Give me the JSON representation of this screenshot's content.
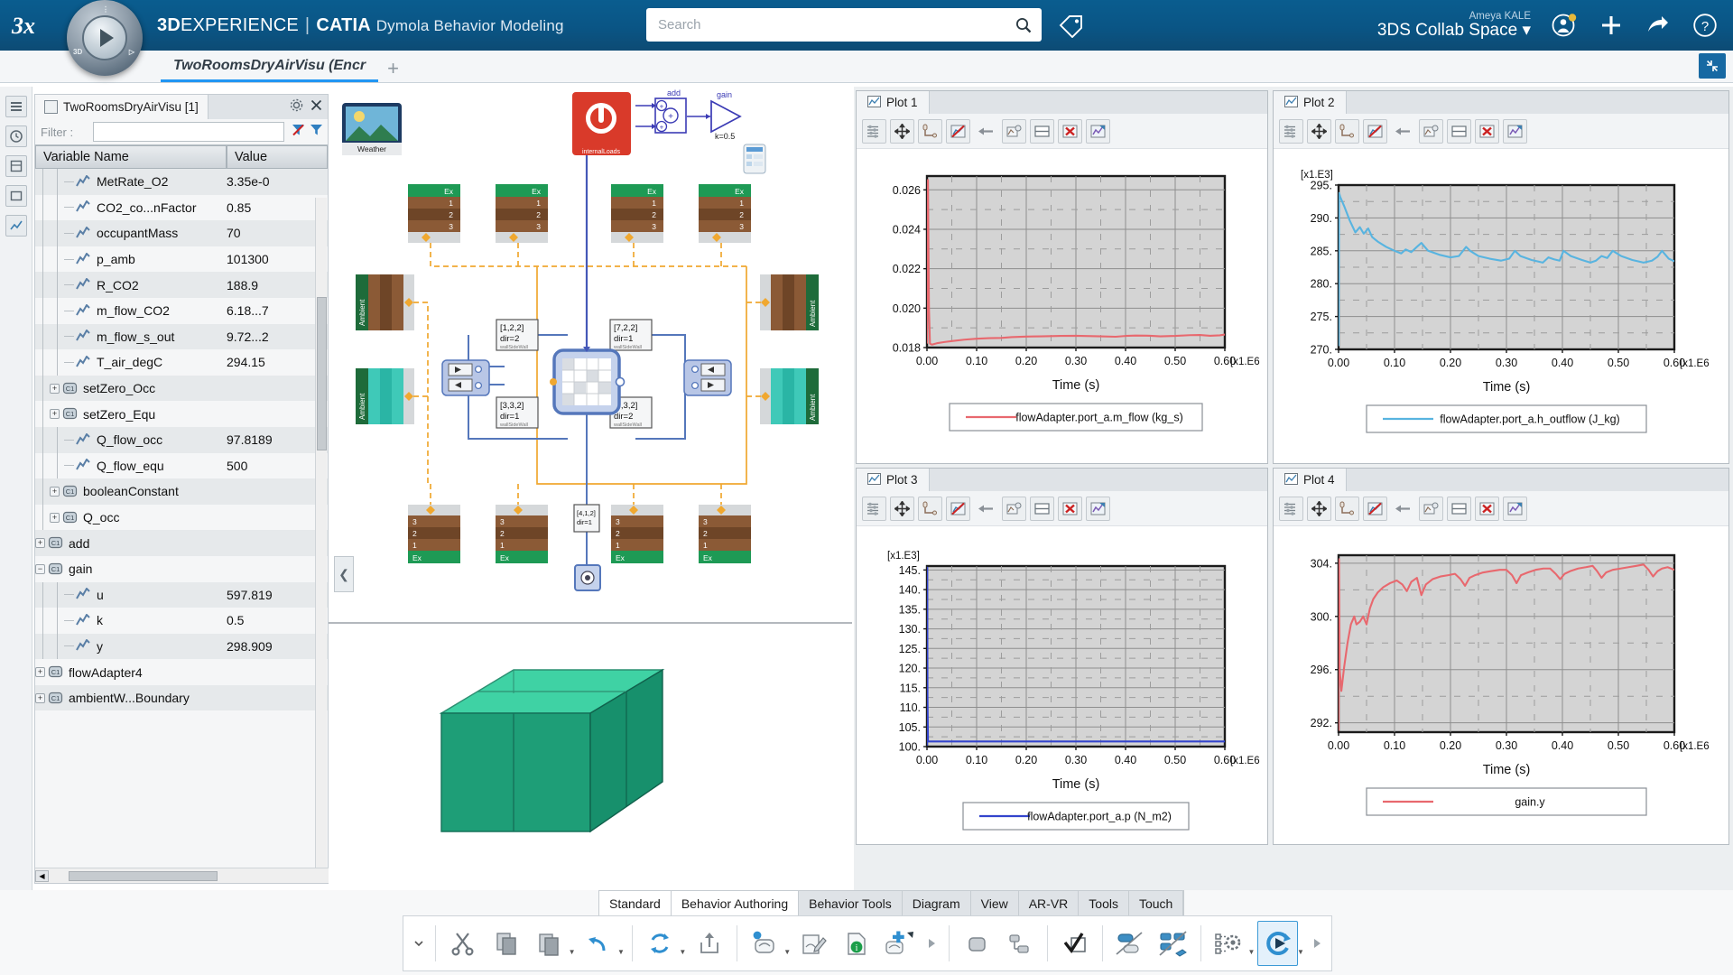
{
  "header": {
    "brand_bold": "3D",
    "brand_rest": "EXPERIENCE",
    "brand_sep": "|",
    "brand_app": "CATIA",
    "brand_sub": "Dymola Behavior Modeling",
    "search_placeholder": "Search",
    "search_value": "",
    "user_name": "Ameya KALE",
    "collab_space": "3DS Collab Space",
    "collab_caret": "⌄",
    "icons": [
      "search-icon",
      "tag-icon",
      "user-account-icon",
      "add-icon",
      "share-icon",
      "help-icon"
    ]
  },
  "tabbar": {
    "document_tab": "TwoRoomsDryAirVisu (Encr",
    "add_tab": "+",
    "collapse_label": "⇲"
  },
  "variable_panel": {
    "tab_title": "TwoRoomsDryAirVisu [1]",
    "filter_label": "Filter :",
    "filter_value": "",
    "columns": [
      "Variable Name",
      "Value"
    ],
    "rows": [
      {
        "name": "MetRate_O2",
        "value": "3.35e-0",
        "indent": 3,
        "kind": "signal"
      },
      {
        "name": "CO2_co...nFactor",
        "value": "0.85",
        "indent": 3,
        "kind": "signal"
      },
      {
        "name": "occupantMass",
        "value": "70",
        "indent": 3,
        "kind": "signal"
      },
      {
        "name": "p_amb",
        "value": "101300",
        "indent": 3,
        "kind": "signal"
      },
      {
        "name": "R_CO2",
        "value": "188.9",
        "indent": 3,
        "kind": "signal"
      },
      {
        "name": "m_flow_CO2",
        "value": "6.18...7",
        "indent": 3,
        "kind": "signal"
      },
      {
        "name": "m_flow_s_out",
        "value": "9.72...2",
        "indent": 3,
        "kind": "signal"
      },
      {
        "name": "T_air_degC",
        "value": "294.15",
        "indent": 3,
        "kind": "signal"
      },
      {
        "name": "setZero_Occ",
        "value": "",
        "indent": 2,
        "kind": "component",
        "expandable": true,
        "expanded": false
      },
      {
        "name": "setZero_Equ",
        "value": "",
        "indent": 2,
        "kind": "component",
        "expandable": true,
        "expanded": false
      },
      {
        "name": "Q_flow_occ",
        "value": "97.8189",
        "indent": 3,
        "kind": "signal"
      },
      {
        "name": "Q_flow_equ",
        "value": "500",
        "indent": 3,
        "kind": "signal"
      },
      {
        "name": "booleanConstant",
        "value": "",
        "indent": 2,
        "kind": "component",
        "expandable": true,
        "expanded": false
      },
      {
        "name": "Q_occ",
        "value": "",
        "indent": 2,
        "kind": "component",
        "expandable": true,
        "expanded": false
      },
      {
        "name": "add",
        "value": "",
        "indent": 1,
        "kind": "component",
        "expandable": true,
        "expanded": false
      },
      {
        "name": "gain",
        "value": "",
        "indent": 1,
        "kind": "component",
        "expandable": true,
        "expanded": true
      },
      {
        "name": "u",
        "value": "597.819",
        "indent": 3,
        "kind": "signal"
      },
      {
        "name": "k",
        "value": "0.5",
        "indent": 3,
        "kind": "signal"
      },
      {
        "name": "y",
        "value": "298.909",
        "indent": 3,
        "kind": "signal"
      },
      {
        "name": "flowAdapter4",
        "value": "",
        "indent": 1,
        "kind": "component",
        "expandable": true,
        "expanded": false
      },
      {
        "name": "ambientW...Boundary",
        "value": "",
        "indent": 1,
        "kind": "component",
        "expandable": true,
        "expanded": false
      }
    ]
  },
  "diagram": {
    "weather_label": "Weather",
    "gain_label": "gain",
    "gain_k": "k=0.5",
    "add_label": "add",
    "port_blocks": [
      {
        "label": "[1,2,2]",
        "dir": "dir=2"
      },
      {
        "label": "[7,2,2]",
        "dir": "dir=1"
      },
      {
        "label": "[3,3,2]",
        "dir": "dir=1"
      },
      {
        "label": "[5,3,2]",
        "dir": "dir=2"
      }
    ],
    "small_block": "[4,1,2]",
    "ambient_labels": [
      "Ambient",
      "Ambient"
    ],
    "ex_label": "Ex"
  },
  "plots": [
    {
      "title": "Plot 1",
      "tab_icon": "chart-icon",
      "toolbar_icons": [
        "variables-icon",
        "pan-icon",
        "axis-icon",
        "no-signal-icon",
        "back-arrow-icon",
        "copy-plot-icon",
        "split-icon",
        "delete-icon",
        "export-icon"
      ],
      "chart_data": {
        "type": "line",
        "title": "",
        "xlabel": "Time (s)",
        "ylabel": "",
        "x_exponent": "[x1.E6",
        "y_exponent": "",
        "xticks": [
          "0.00",
          "0.10",
          "0.20",
          "0.30",
          "0.40",
          "0.50",
          "0.60"
        ],
        "yticks": [
          "0.018",
          "0.020",
          "0.022",
          "0.024",
          "0.026"
        ],
        "xlim": [
          0.0,
          0.6
        ],
        "ylim": [
          0.018,
          0.0267
        ],
        "grid": true,
        "legend_position": "below",
        "series": [
          {
            "name": "flowAdapter.port_a.m_flow (kg_s)",
            "color": "#e8686e",
            "x": [
              0.0,
              0.002,
              0.004,
              0.006,
              0.01,
              0.02,
              0.035,
              0.05,
              0.075,
              0.1,
              0.125,
              0.15,
              0.17,
              0.2,
              0.23,
              0.25,
              0.27,
              0.3,
              0.33,
              0.35,
              0.38,
              0.4,
              0.42,
              0.45,
              0.47,
              0.5,
              0.53,
              0.55,
              0.57,
              0.59,
              0.6
            ],
            "y": [
              0.0182,
              0.0265,
              0.02,
              0.0182,
              0.01815,
              0.01822,
              0.01828,
              0.01833,
              0.0184,
              0.01845,
              0.01848,
              0.01849,
              0.01853,
              0.01856,
              0.01857,
              0.01858,
              0.01859,
              0.0186,
              0.01858,
              0.01857,
              0.01855,
              0.01859,
              0.01861,
              0.0186,
              0.01857,
              0.01859,
              0.01863,
              0.01864,
              0.0186,
              0.01862,
              0.01866
            ]
          }
        ]
      }
    },
    {
      "title": "Plot 2",
      "tab_icon": "chart-icon",
      "toolbar_icons": [
        "variables-icon",
        "pan-icon",
        "axis-icon",
        "no-signal-icon",
        "back-arrow-icon",
        "copy-plot-icon",
        "split-icon",
        "delete-icon",
        "export-icon"
      ],
      "chart_data": {
        "type": "line",
        "title": "",
        "xlabel": "Time (s)",
        "ylabel": "",
        "x_exponent": "[x1.E6",
        "y_exponent": "[x1.E3]",
        "xticks": [
          "0.00",
          "0.10",
          "0.20",
          "0.30",
          "0.40",
          "0.50",
          "0.60"
        ],
        "yticks": [
          "270.",
          "275.",
          "280.",
          "285.",
          "290.",
          "295."
        ],
        "xlim": [
          0.0,
          0.6
        ],
        "ylim": [
          270,
          295
        ],
        "grid": true,
        "legend_position": "below",
        "series": [
          {
            "name": "flowAdapter.port_a.h_outflow (J_kg)",
            "color": "#58b4e0",
            "x": [
              0.0,
              0.001,
              0.003,
              0.01,
              0.02,
              0.03,
              0.038,
              0.045,
              0.053,
              0.06,
              0.07,
              0.085,
              0.1,
              0.112,
              0.12,
              0.13,
              0.14,
              0.148,
              0.16,
              0.18,
              0.2,
              0.215,
              0.228,
              0.235,
              0.25,
              0.27,
              0.29,
              0.305,
              0.315,
              0.325,
              0.345,
              0.365,
              0.375,
              0.385,
              0.395,
              0.402,
              0.415,
              0.435,
              0.45,
              0.46,
              0.47,
              0.48,
              0.49,
              0.505,
              0.525,
              0.545,
              0.56,
              0.57,
              0.578,
              0.59,
              0.6
            ],
            "y": [
              270.5,
              293.8,
              293.2,
              291.8,
              289.6,
              287.8,
              288.6,
              287.6,
              288.4,
              287.1,
              286.4,
              285.6,
              285.0,
              284.6,
              285.2,
              284.8,
              285.6,
              286.2,
              285.0,
              284.4,
              284.0,
              284.2,
              285.6,
              285.0,
              284.2,
              283.8,
              283.5,
              283.8,
              285.0,
              284.2,
              283.6,
              283.2,
              284.0,
              283.7,
              283.5,
              285.0,
              284.2,
              283.6,
              283.2,
              283.5,
              284.2,
              283.9,
              285.0,
              284.2,
              283.6,
              283.2,
              283.5,
              284.1,
              285.0,
              283.8,
              283.4
            ]
          }
        ]
      }
    },
    {
      "title": "Plot 3",
      "tab_icon": "chart-icon",
      "toolbar_icons": [
        "variables-icon",
        "pan-icon",
        "axis-icon",
        "no-signal-icon",
        "back-arrow-icon",
        "copy-plot-icon",
        "split-icon",
        "delete-icon",
        "export-icon"
      ],
      "chart_data": {
        "type": "line",
        "title": "",
        "xlabel": "Time (s)",
        "ylabel": "",
        "x_exponent": "[x1.E6",
        "y_exponent": "[x1.E3]",
        "xticks": [
          "0.00",
          "0.10",
          "0.20",
          "0.30",
          "0.40",
          "0.50",
          "0.60"
        ],
        "yticks": [
          "100.",
          "105.",
          "110.",
          "115.",
          "120.",
          "125.",
          "130.",
          "135.",
          "140.",
          "145."
        ],
        "xlim": [
          0.0,
          0.6
        ],
        "ylim": [
          100,
          146
        ],
        "grid": true,
        "legend_position": "below",
        "series": [
          {
            "name": "flowAdapter.port_a.p (N_m2)",
            "color": "#3344cc",
            "x": [
              0.0,
              0.0005,
              0.001,
              0.002,
              0.005,
              0.01,
              0.05,
              0.1,
              0.2,
              0.3,
              0.4,
              0.5,
              0.6
            ],
            "y": [
              100.3,
              145.6,
              113.0,
              101.3,
              101.3,
              101.3,
              101.3,
              101.3,
              101.3,
              101.3,
              101.3,
              101.3,
              101.3
            ]
          }
        ]
      }
    },
    {
      "title": "Plot 4",
      "tab_icon": "chart-icon",
      "toolbar_icons": [
        "variables-icon",
        "pan-icon",
        "axis-icon",
        "no-signal-icon",
        "back-arrow-icon",
        "copy-plot-icon",
        "split-icon",
        "delete-icon",
        "export-icon"
      ],
      "chart_data": {
        "type": "line",
        "title": "",
        "xlabel": "Time (s)",
        "ylabel": "",
        "x_exponent": "[x1.E6",
        "y_exponent": "",
        "xticks": [
          "0.00",
          "0.10",
          "0.20",
          "0.30",
          "0.40",
          "0.50",
          "0.60"
        ],
        "yticks": [
          "292.",
          "296.",
          "300.",
          "304."
        ],
        "xlim": [
          0.0,
          0.6
        ],
        "ylim": [
          291.3,
          304.6
        ],
        "grid": true,
        "legend_position": "below",
        "series": [
          {
            "name": "gain.y",
            "color": "#e8686e",
            "x": [
              0.0,
              0.0008,
              0.002,
              0.005,
              0.01,
              0.016,
              0.022,
              0.028,
              0.032,
              0.038,
              0.044,
              0.05,
              0.056,
              0.062,
              0.07,
              0.08,
              0.092,
              0.104,
              0.114,
              0.122,
              0.13,
              0.14,
              0.148,
              0.156,
              0.168,
              0.182,
              0.196,
              0.208,
              0.218,
              0.226,
              0.234,
              0.244,
              0.258,
              0.272,
              0.288,
              0.3,
              0.31,
              0.318,
              0.326,
              0.338,
              0.352,
              0.366,
              0.378,
              0.388,
              0.396,
              0.404,
              0.414,
              0.428,
              0.442,
              0.454,
              0.462,
              0.47,
              0.478,
              0.49,
              0.504,
              0.518,
              0.532,
              0.545,
              0.554,
              0.562,
              0.57,
              0.578,
              0.588,
              0.6
            ],
            "y": [
              291.4,
              304.3,
              296.0,
              294.4,
              296.2,
              298.0,
              299.4,
              300.0,
              299.4,
              299.6,
              300.0,
              299.4,
              300.6,
              301.3,
              301.8,
              302.2,
              302.5,
              302.7,
              302.4,
              301.9,
              302.6,
              302.9,
              301.6,
              302.4,
              302.8,
              303.0,
              303.1,
              303.2,
              302.8,
              302.3,
              302.9,
              303.1,
              303.3,
              303.4,
              303.5,
              303.5,
              303.1,
              302.5,
              303.1,
              303.3,
              303.5,
              303.6,
              303.6,
              303.2,
              302.8,
              303.2,
              303.4,
              303.6,
              303.7,
              303.8,
              303.4,
              302.9,
              303.3,
              303.5,
              303.6,
              303.7,
              303.8,
              303.9,
              303.5,
              303.0,
              303.4,
              303.6,
              303.7,
              303.5
            ]
          }
        ]
      }
    }
  ],
  "action_bar": {
    "tabs": [
      {
        "label": "Standard",
        "active": true
      },
      {
        "label": "Behavior Authoring",
        "active": true
      },
      {
        "label": "Behavior Tools",
        "active": false
      },
      {
        "label": "Diagram",
        "active": false
      },
      {
        "label": "View",
        "active": false
      },
      {
        "label": "AR-VR",
        "active": false
      },
      {
        "label": "Tools",
        "active": false
      },
      {
        "label": "Touch",
        "active": false
      }
    ],
    "tools": [
      {
        "name": "collapse-chevron-icon",
        "kind": "chevron"
      },
      {
        "name": "cut-icon",
        "kind": "icon"
      },
      {
        "name": "copy-icon",
        "kind": "icon"
      },
      {
        "name": "paste-icon",
        "kind": "icon",
        "dropdown": true
      },
      {
        "name": "undo-icon",
        "kind": "icon",
        "dropdown": true
      },
      {
        "name": "divider",
        "kind": "div"
      },
      {
        "name": "update-icon",
        "kind": "icon",
        "dropdown": true
      },
      {
        "name": "export-icon",
        "kind": "icon"
      },
      {
        "name": "divider",
        "kind": "div"
      },
      {
        "name": "new-behavior-icon",
        "kind": "icon",
        "dropdown": true
      },
      {
        "name": "edit-behavior-icon",
        "kind": "icon"
      },
      {
        "name": "info-document-icon",
        "kind": "icon"
      },
      {
        "name": "add-behavior-icon",
        "kind": "icon",
        "dropdown": true
      },
      {
        "name": "divider",
        "kind": "div"
      },
      {
        "name": "rounded-rect-icon",
        "kind": "icon"
      },
      {
        "name": "align-icon",
        "kind": "icon"
      },
      {
        "name": "divider",
        "kind": "div"
      },
      {
        "name": "check-icon",
        "kind": "icon"
      },
      {
        "name": "divider",
        "kind": "div"
      },
      {
        "name": "disconnect-icon",
        "kind": "icon"
      },
      {
        "name": "link-3d-icon",
        "kind": "icon"
      },
      {
        "name": "divider",
        "kind": "div"
      },
      {
        "name": "settings-gear-icon",
        "kind": "icon",
        "dropdown": true
      },
      {
        "name": "simulate-icon",
        "kind": "icon",
        "selected": true,
        "dropdown": true
      },
      {
        "name": "more-arrow-icon",
        "kind": "chevron"
      }
    ]
  },
  "colors": {
    "brand_blue": "#0a5585",
    "accent": "#2196f3",
    "plot_red": "#e8686e",
    "plot_cyan": "#58b4e0",
    "plot_blue": "#3344cc",
    "panel_bg": "#f5f6f7",
    "row_alt": "#e6e9eb"
  }
}
